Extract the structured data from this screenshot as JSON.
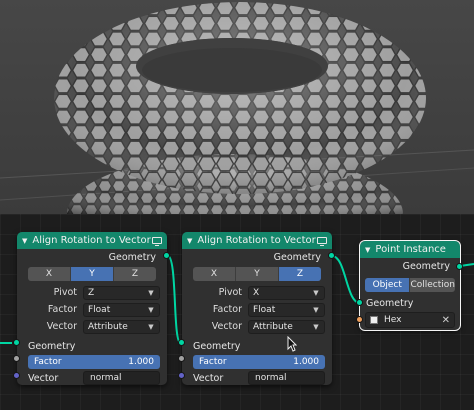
{
  "nodes": [
    {
      "title": "Align Rotation to Vector",
      "output": "Geometry",
      "axis_options": [
        "X",
        "Y",
        "Z"
      ],
      "axis_selected": "Y",
      "pivot_label": "Pivot",
      "pivot_value": "Z",
      "factor_label": "Factor",
      "factor_value": "Float",
      "vector_label": "Vector",
      "vector_value": "Attribute",
      "inputs": {
        "geometry": "Geometry",
        "factor_name": "Factor",
        "factor_amount": "1.000",
        "vector_name": "Vector",
        "vector_field": "normal"
      }
    },
    {
      "title": "Align Rotation to Vector",
      "output": "Geometry",
      "axis_options": [
        "X",
        "Y",
        "Z"
      ],
      "axis_selected": "Z",
      "pivot_label": "Pivot",
      "pivot_value": "X",
      "factor_label": "Factor",
      "factor_value": "Float",
      "vector_label": "Vector",
      "vector_value": "Attribute",
      "inputs": {
        "geometry": "Geometry",
        "factor_name": "Factor",
        "factor_amount": "1.000",
        "vector_name": "Vector",
        "vector_field": "normal"
      }
    },
    {
      "title": "Point Instance",
      "output": "Geometry",
      "mode_options": [
        "Object",
        "Collection"
      ],
      "mode_selected": "Object",
      "input_geometry": "Geometry",
      "object_value": "Hex"
    }
  ],
  "colors": {
    "node_header": "#13876b",
    "active_blue": "#4772b3",
    "socket_geometry": "#00d6a3",
    "socket_float": "#a1a1a1",
    "socket_vector": "#6363c7",
    "socket_object": "#ed9e5c"
  },
  "icons": [
    "node-collapse-chevron-icon",
    "node-preview-screen-icon",
    "dropdown-chevron-icon",
    "object-square-icon",
    "clear-x-icon",
    "mouse-cursor-icon"
  ]
}
